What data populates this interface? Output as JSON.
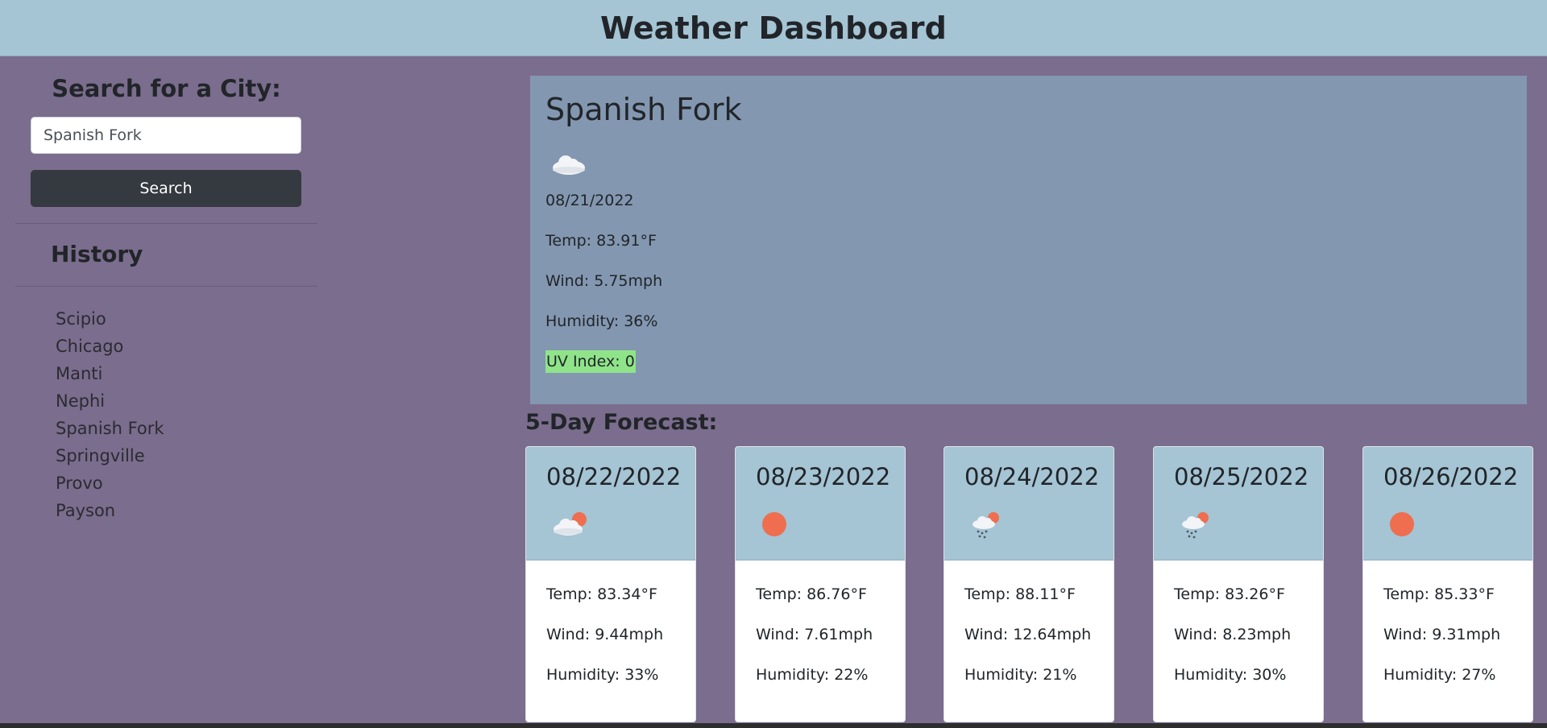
{
  "header": {
    "title": "Weather Dashboard"
  },
  "sidebar": {
    "search_title": "Search for a City:",
    "search_value": "Spanish Fork",
    "search_button": "Search",
    "history_title": "History",
    "history": [
      "Scipio",
      "Chicago",
      "Manti",
      "Nephi",
      "Spanish Fork",
      "Springville",
      "Provo",
      "Payson"
    ]
  },
  "current": {
    "city": "Spanish Fork",
    "icon": "cloud-icon",
    "date": "08/21/2022",
    "temp": "Temp: 83.91°F",
    "wind": "Wind: 5.75mph",
    "humidity": "Humidity: 36%",
    "uv": "UV Index: 0",
    "uv_color": "#8fe48a"
  },
  "forecast": {
    "title": "5-Day Forecast:",
    "days": [
      {
        "date": "08/22/2022",
        "icon": "partly-cloudy-icon",
        "temp": "Temp: 83.34°F",
        "wind": "Wind: 9.44mph",
        "humidity": "Humidity: 33%"
      },
      {
        "date": "08/23/2022",
        "icon": "sun-icon",
        "temp": "Temp: 86.76°F",
        "wind": "Wind: 7.61mph",
        "humidity": "Humidity: 22%"
      },
      {
        "date": "08/24/2022",
        "icon": "rain-sun-icon",
        "temp": "Temp: 88.11°F",
        "wind": "Wind: 12.64mph",
        "humidity": "Humidity: 21%"
      },
      {
        "date": "08/25/2022",
        "icon": "rain-sun-icon",
        "temp": "Temp: 83.26°F",
        "wind": "Wind: 8.23mph",
        "humidity": "Humidity: 30%"
      },
      {
        "date": "08/26/2022",
        "icon": "sun-icon",
        "temp": "Temp: 85.33°F",
        "wind": "Wind: 9.31mph",
        "humidity": "Humidity: 27%"
      }
    ]
  },
  "colors": {
    "background": "#7b6d8d",
    "header": "#a5c4d4",
    "current_panel": "#8397b0",
    "button": "#343a40",
    "sun": "#ee6e4f"
  }
}
